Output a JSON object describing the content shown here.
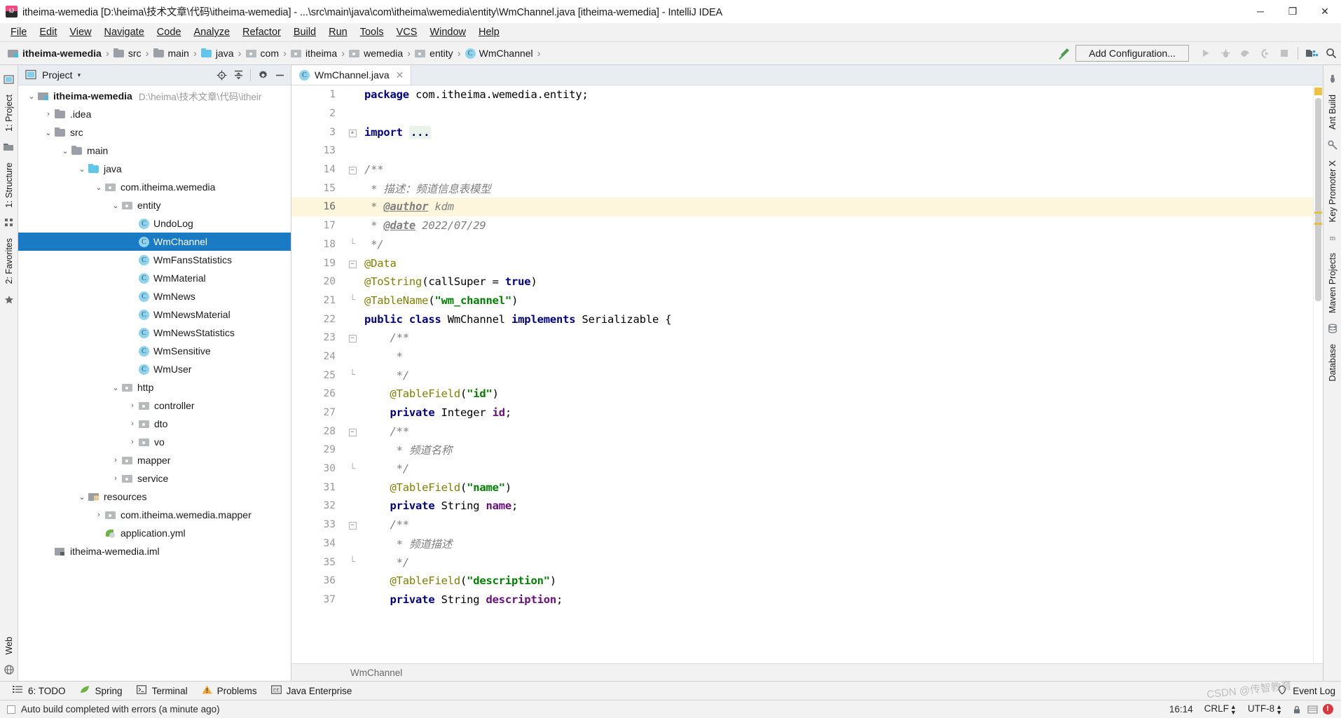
{
  "window": {
    "title": "itheima-wemedia [D:\\heima\\技术文章\\代码\\itheima-wemedia] - ...\\src\\main\\java\\com\\itheima\\wemedia\\entity\\WmChannel.java [itheima-wemedia] - IntelliJ IDEA",
    "minimize": "─",
    "maximize": "❐",
    "close": "✕"
  },
  "menubar": {
    "items": [
      "File",
      "Edit",
      "View",
      "Navigate",
      "Code",
      "Analyze",
      "Refactor",
      "Build",
      "Run",
      "Tools",
      "VCS",
      "Window",
      "Help"
    ]
  },
  "navbar": {
    "crumbs": [
      {
        "label": "itheima-wemedia",
        "icon": "module-icon"
      },
      {
        "label": "src",
        "icon": "folder-icon"
      },
      {
        "label": "main",
        "icon": "folder-icon"
      },
      {
        "label": "java",
        "icon": "source-folder-icon"
      },
      {
        "label": "com",
        "icon": "package-icon"
      },
      {
        "label": "itheima",
        "icon": "package-icon"
      },
      {
        "label": "wemedia",
        "icon": "package-icon"
      },
      {
        "label": "entity",
        "icon": "package-icon"
      },
      {
        "label": "WmChannel",
        "icon": "class-icon"
      }
    ],
    "separator": "›",
    "add_configuration": "Add Configuration...",
    "toolbar_icons": [
      "build-hammer-icon",
      "run-icon",
      "debug-icon",
      "run-coverage-icon",
      "run-profiler-icon",
      "stop-icon",
      "project-structure-icon",
      "search-icon"
    ]
  },
  "left_strip": {
    "top": [
      {
        "label": "1: Project",
        "icon": "project-icon"
      }
    ],
    "items": [
      {
        "label": "1: Structure",
        "icon": "structure-icon"
      },
      {
        "label": "2: Favorites",
        "icon": "favorites-icon"
      }
    ],
    "bottom": [
      {
        "label": "Web",
        "icon": "web-icon"
      }
    ]
  },
  "right_strip": {
    "items": [
      {
        "label": "Ant Build",
        "icon": "ant-icon"
      },
      {
        "label": "Key Promoter X",
        "icon": "key-promoter-icon"
      },
      {
        "label": "Maven Projects",
        "icon": "maven-icon"
      },
      {
        "label": "Database",
        "icon": "database-icon"
      }
    ]
  },
  "project_panel": {
    "title": "Project",
    "caret": "▾",
    "actions": [
      "locate-icon",
      "collapse-all-icon",
      "settings-gear-icon",
      "hide-icon"
    ],
    "tree": [
      {
        "depth": 0,
        "twist": "⌄",
        "icon": "module-icon",
        "label": "itheima-wemedia",
        "bold": true,
        "path": "D:\\heima\\技术文章\\代码\\itheir",
        "selected": false
      },
      {
        "depth": 1,
        "twist": "›",
        "icon": "folder-icon",
        "label": ".idea",
        "selected": false
      },
      {
        "depth": 1,
        "twist": "⌄",
        "icon": "folder-icon",
        "label": "src",
        "selected": false
      },
      {
        "depth": 2,
        "twist": "⌄",
        "icon": "folder-icon",
        "label": "main",
        "selected": false
      },
      {
        "depth": 3,
        "twist": "⌄",
        "icon": "source-folder-icon",
        "label": "java",
        "selected": false
      },
      {
        "depth": 4,
        "twist": "⌄",
        "icon": "package-icon",
        "label": "com.itheima.wemedia",
        "selected": false
      },
      {
        "depth": 5,
        "twist": "⌄",
        "icon": "package-icon",
        "label": "entity",
        "selected": false
      },
      {
        "depth": 6,
        "twist": "",
        "icon": "class-icon",
        "label": "UndoLog",
        "selected": false
      },
      {
        "depth": 6,
        "twist": "",
        "icon": "class-icon",
        "label": "WmChannel",
        "selected": true
      },
      {
        "depth": 6,
        "twist": "",
        "icon": "class-icon",
        "label": "WmFansStatistics",
        "selected": false
      },
      {
        "depth": 6,
        "twist": "",
        "icon": "class-icon",
        "label": "WmMaterial",
        "selected": false
      },
      {
        "depth": 6,
        "twist": "",
        "icon": "class-icon",
        "label": "WmNews",
        "selected": false
      },
      {
        "depth": 6,
        "twist": "",
        "icon": "class-icon",
        "label": "WmNewsMaterial",
        "selected": false
      },
      {
        "depth": 6,
        "twist": "",
        "icon": "class-icon",
        "label": "WmNewsStatistics",
        "selected": false
      },
      {
        "depth": 6,
        "twist": "",
        "icon": "class-icon",
        "label": "WmSensitive",
        "selected": false
      },
      {
        "depth": 6,
        "twist": "",
        "icon": "class-icon",
        "label": "WmUser",
        "selected": false
      },
      {
        "depth": 5,
        "twist": "⌄",
        "icon": "package-icon",
        "label": "http",
        "selected": false
      },
      {
        "depth": 6,
        "twist": "›",
        "icon": "package-icon",
        "label": "controller",
        "selected": false
      },
      {
        "depth": 6,
        "twist": "›",
        "icon": "package-icon",
        "label": "dto",
        "selected": false
      },
      {
        "depth": 6,
        "twist": "›",
        "icon": "package-icon",
        "label": "vo",
        "selected": false
      },
      {
        "depth": 5,
        "twist": "›",
        "icon": "package-icon",
        "label": "mapper",
        "selected": false
      },
      {
        "depth": 5,
        "twist": "›",
        "icon": "package-icon",
        "label": "service",
        "selected": false
      },
      {
        "depth": 3,
        "twist": "⌄",
        "icon": "resources-icon",
        "label": "resources",
        "selected": false
      },
      {
        "depth": 4,
        "twist": "›",
        "icon": "package-icon",
        "label": "com.itheima.wemedia.mapper",
        "selected": false
      },
      {
        "depth": 4,
        "twist": "",
        "icon": "yml-icon",
        "label": "application.yml",
        "selected": false
      },
      {
        "depth": 1,
        "twist": "",
        "icon": "iml-icon",
        "label": "itheima-wemedia.iml",
        "selected": false
      }
    ]
  },
  "editor": {
    "tab": {
      "label": "WmChannel.java",
      "icon": "class-icon",
      "close": "✕"
    },
    "breadcrumb": "WmChannel",
    "current_line": 16,
    "lines": [
      {
        "n": "1",
        "fold": "",
        "tokens": [
          {
            "t": "package",
            "c": "kw"
          },
          {
            "t": " com.itheima.wemedia.entity;",
            "c": "plain"
          }
        ]
      },
      {
        "n": "2",
        "fold": "",
        "tokens": []
      },
      {
        "n": "3",
        "fold": "+",
        "tokens": [
          {
            "t": "import",
            "c": "kw"
          },
          {
            "t": " ",
            "c": "plain"
          },
          {
            "t": "...",
            "c": "imp-dots"
          }
        ]
      },
      {
        "n": "13",
        "fold": "",
        "tokens": []
      },
      {
        "n": "14",
        "fold": "-",
        "tokens": [
          {
            "t": "/**",
            "c": "cmt"
          }
        ]
      },
      {
        "n": "15",
        "fold": "",
        "tokens": [
          {
            "t": " * ",
            "c": "cmt"
          },
          {
            "t": "描述：频道信息表模型",
            "c": "cmt"
          }
        ]
      },
      {
        "n": "16",
        "fold": "",
        "tokens": [
          {
            "t": " * ",
            "c": "cmt"
          },
          {
            "t": "@author",
            "c": "tagb"
          },
          {
            "t": " kdm",
            "c": "cmt"
          }
        ]
      },
      {
        "n": "17",
        "fold": "",
        "tokens": [
          {
            "t": " * ",
            "c": "cmt"
          },
          {
            "t": "@date",
            "c": "tagb"
          },
          {
            "t": " 2022/07/29",
            "c": "cmt"
          }
        ]
      },
      {
        "n": "18",
        "fold": "^",
        "tokens": [
          {
            "t": " */",
            "c": "cmt"
          }
        ]
      },
      {
        "n": "19",
        "fold": "-",
        "tokens": [
          {
            "t": "@Data",
            "c": "ann"
          }
        ]
      },
      {
        "n": "20",
        "fold": "",
        "tokens": [
          {
            "t": "@ToString",
            "c": "ann"
          },
          {
            "t": "(callSuper = ",
            "c": "plain"
          },
          {
            "t": "true",
            "c": "kw"
          },
          {
            "t": ")",
            "c": "plain"
          }
        ]
      },
      {
        "n": "21",
        "fold": "^",
        "tokens": [
          {
            "t": "@TableName",
            "c": "ann"
          },
          {
            "t": "(",
            "c": "plain"
          },
          {
            "t": "\"wm_channel\"",
            "c": "str"
          },
          {
            "t": ")",
            "c": "plain"
          }
        ]
      },
      {
        "n": "22",
        "fold": "",
        "tokens": [
          {
            "t": "public class",
            "c": "kw"
          },
          {
            "t": " WmChannel ",
            "c": "plain"
          },
          {
            "t": "implements",
            "c": "kw"
          },
          {
            "t": " Serializable {",
            "c": "plain"
          }
        ]
      },
      {
        "n": "23",
        "fold": "-",
        "tokens": [
          {
            "t": "    /**",
            "c": "cmt"
          }
        ]
      },
      {
        "n": "24",
        "fold": "",
        "tokens": [
          {
            "t": "     *",
            "c": "cmt"
          }
        ]
      },
      {
        "n": "25",
        "fold": "^",
        "tokens": [
          {
            "t": "     */",
            "c": "cmt"
          }
        ]
      },
      {
        "n": "26",
        "fold": "",
        "tokens": [
          {
            "t": "    @TableField",
            "c": "ann"
          },
          {
            "t": "(",
            "c": "plain"
          },
          {
            "t": "\"id\"",
            "c": "str"
          },
          {
            "t": ")",
            "c": "plain"
          }
        ]
      },
      {
        "n": "27",
        "fold": "",
        "tokens": [
          {
            "t": "    private",
            "c": "kw"
          },
          {
            "t": " Integer ",
            "c": "plain"
          },
          {
            "t": "id",
            "c": "fld"
          },
          {
            "t": ";",
            "c": "plain"
          }
        ]
      },
      {
        "n": "28",
        "fold": "-",
        "tokens": [
          {
            "t": "    /**",
            "c": "cmt"
          }
        ]
      },
      {
        "n": "29",
        "fold": "",
        "tokens": [
          {
            "t": "     * ",
            "c": "cmt"
          },
          {
            "t": "频道名称",
            "c": "cmt"
          }
        ]
      },
      {
        "n": "30",
        "fold": "^",
        "tokens": [
          {
            "t": "     */",
            "c": "cmt"
          }
        ]
      },
      {
        "n": "31",
        "fold": "",
        "tokens": [
          {
            "t": "    @TableField",
            "c": "ann"
          },
          {
            "t": "(",
            "c": "plain"
          },
          {
            "t": "\"name\"",
            "c": "str"
          },
          {
            "t": ")",
            "c": "plain"
          }
        ]
      },
      {
        "n": "32",
        "fold": "",
        "tokens": [
          {
            "t": "    private",
            "c": "kw"
          },
          {
            "t": " String ",
            "c": "plain"
          },
          {
            "t": "name",
            "c": "fld"
          },
          {
            "t": ";",
            "c": "plain"
          }
        ]
      },
      {
        "n": "33",
        "fold": "-",
        "tokens": [
          {
            "t": "    /**",
            "c": "cmt"
          }
        ]
      },
      {
        "n": "34",
        "fold": "",
        "tokens": [
          {
            "t": "     * ",
            "c": "cmt"
          },
          {
            "t": "频道描述",
            "c": "cmt"
          }
        ]
      },
      {
        "n": "35",
        "fold": "^",
        "tokens": [
          {
            "t": "     */",
            "c": "cmt"
          }
        ]
      },
      {
        "n": "36",
        "fold": "",
        "tokens": [
          {
            "t": "    @TableField",
            "c": "ann"
          },
          {
            "t": "(",
            "c": "plain"
          },
          {
            "t": "\"description\"",
            "c": "str"
          },
          {
            "t": ")",
            "c": "plain"
          }
        ]
      },
      {
        "n": "37",
        "fold": "",
        "tokens": [
          {
            "t": "    private",
            "c": "kw"
          },
          {
            "t": " String ",
            "c": "plain"
          },
          {
            "t": "description",
            "c": "fld"
          },
          {
            "t": ";",
            "c": "plain"
          }
        ]
      }
    ]
  },
  "toolwindow_bar": {
    "items": [
      {
        "label": "6: TODO",
        "icon": "todo-icon",
        "mnemonic": "6"
      },
      {
        "label": "Spring",
        "icon": "spring-leaf-icon"
      },
      {
        "label": "Terminal",
        "icon": "terminal-icon"
      },
      {
        "label": "Problems",
        "icon": "warning-triangle-icon"
      },
      {
        "label": "Java Enterprise",
        "icon": "java-enterprise-icon"
      }
    ],
    "event_log": {
      "label": "Event Log",
      "icon": "event-log-icon"
    }
  },
  "statusbar": {
    "message": "Auto build completed with errors (a minute ago)",
    "time": "16:14",
    "line_separator": "CRLF",
    "encoding": "UTF-8",
    "lock_icon": "lock-icon",
    "inspection_icon": "inspection-icon",
    "error_badge": "!",
    "watermark": "CSDN @传智教育"
  },
  "colors": {
    "selection_blue": "#1a7ac4",
    "accent_cyan": "#62c6e8",
    "keyword_navy": "#000080",
    "string_green": "#008000",
    "annotation_olive": "#808000",
    "comment_gray": "#808080",
    "field_purple": "#660e7a",
    "current_line_yellow": "#fdf6dd",
    "error_red": "#d9363e"
  }
}
